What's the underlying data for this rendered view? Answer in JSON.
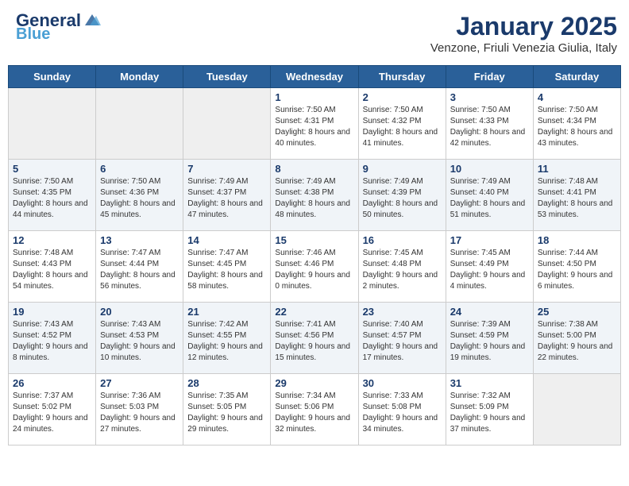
{
  "header": {
    "logo_general": "General",
    "logo_blue": "Blue",
    "title": "January 2025",
    "subtitle": "Venzone, Friuli Venezia Giulia, Italy"
  },
  "weekdays": [
    "Sunday",
    "Monday",
    "Tuesday",
    "Wednesday",
    "Thursday",
    "Friday",
    "Saturday"
  ],
  "weeks": [
    {
      "days": [
        {
          "num": "",
          "empty": true
        },
        {
          "num": "",
          "empty": true
        },
        {
          "num": "",
          "empty": true
        },
        {
          "num": "1",
          "rise": "7:50 AM",
          "set": "4:31 PM",
          "daylight": "8 hours and 40 minutes."
        },
        {
          "num": "2",
          "rise": "7:50 AM",
          "set": "4:32 PM",
          "daylight": "8 hours and 41 minutes."
        },
        {
          "num": "3",
          "rise": "7:50 AM",
          "set": "4:33 PM",
          "daylight": "8 hours and 42 minutes."
        },
        {
          "num": "4",
          "rise": "7:50 AM",
          "set": "4:34 PM",
          "daylight": "8 hours and 43 minutes."
        }
      ]
    },
    {
      "days": [
        {
          "num": "5",
          "rise": "7:50 AM",
          "set": "4:35 PM",
          "daylight": "8 hours and 44 minutes."
        },
        {
          "num": "6",
          "rise": "7:50 AM",
          "set": "4:36 PM",
          "daylight": "8 hours and 45 minutes."
        },
        {
          "num": "7",
          "rise": "7:49 AM",
          "set": "4:37 PM",
          "daylight": "8 hours and 47 minutes."
        },
        {
          "num": "8",
          "rise": "7:49 AM",
          "set": "4:38 PM",
          "daylight": "8 hours and 48 minutes."
        },
        {
          "num": "9",
          "rise": "7:49 AM",
          "set": "4:39 PM",
          "daylight": "8 hours and 50 minutes."
        },
        {
          "num": "10",
          "rise": "7:49 AM",
          "set": "4:40 PM",
          "daylight": "8 hours and 51 minutes."
        },
        {
          "num": "11",
          "rise": "7:48 AM",
          "set": "4:41 PM",
          "daylight": "8 hours and 53 minutes."
        }
      ]
    },
    {
      "days": [
        {
          "num": "12",
          "rise": "7:48 AM",
          "set": "4:43 PM",
          "daylight": "8 hours and 54 minutes."
        },
        {
          "num": "13",
          "rise": "7:47 AM",
          "set": "4:44 PM",
          "daylight": "8 hours and 56 minutes."
        },
        {
          "num": "14",
          "rise": "7:47 AM",
          "set": "4:45 PM",
          "daylight": "8 hours and 58 minutes."
        },
        {
          "num": "15",
          "rise": "7:46 AM",
          "set": "4:46 PM",
          "daylight": "9 hours and 0 minutes."
        },
        {
          "num": "16",
          "rise": "7:45 AM",
          "set": "4:48 PM",
          "daylight": "9 hours and 2 minutes."
        },
        {
          "num": "17",
          "rise": "7:45 AM",
          "set": "4:49 PM",
          "daylight": "9 hours and 4 minutes."
        },
        {
          "num": "18",
          "rise": "7:44 AM",
          "set": "4:50 PM",
          "daylight": "9 hours and 6 minutes."
        }
      ]
    },
    {
      "days": [
        {
          "num": "19",
          "rise": "7:43 AM",
          "set": "4:52 PM",
          "daylight": "9 hours and 8 minutes."
        },
        {
          "num": "20",
          "rise": "7:43 AM",
          "set": "4:53 PM",
          "daylight": "9 hours and 10 minutes."
        },
        {
          "num": "21",
          "rise": "7:42 AM",
          "set": "4:55 PM",
          "daylight": "9 hours and 12 minutes."
        },
        {
          "num": "22",
          "rise": "7:41 AM",
          "set": "4:56 PM",
          "daylight": "9 hours and 15 minutes."
        },
        {
          "num": "23",
          "rise": "7:40 AM",
          "set": "4:57 PM",
          "daylight": "9 hours and 17 minutes."
        },
        {
          "num": "24",
          "rise": "7:39 AM",
          "set": "4:59 PM",
          "daylight": "9 hours and 19 minutes."
        },
        {
          "num": "25",
          "rise": "7:38 AM",
          "set": "5:00 PM",
          "daylight": "9 hours and 22 minutes."
        }
      ]
    },
    {
      "days": [
        {
          "num": "26",
          "rise": "7:37 AM",
          "set": "5:02 PM",
          "daylight": "9 hours and 24 minutes."
        },
        {
          "num": "27",
          "rise": "7:36 AM",
          "set": "5:03 PM",
          "daylight": "9 hours and 27 minutes."
        },
        {
          "num": "28",
          "rise": "7:35 AM",
          "set": "5:05 PM",
          "daylight": "9 hours and 29 minutes."
        },
        {
          "num": "29",
          "rise": "7:34 AM",
          "set": "5:06 PM",
          "daylight": "9 hours and 32 minutes."
        },
        {
          "num": "30",
          "rise": "7:33 AM",
          "set": "5:08 PM",
          "daylight": "9 hours and 34 minutes."
        },
        {
          "num": "31",
          "rise": "7:32 AM",
          "set": "5:09 PM",
          "daylight": "9 hours and 37 minutes."
        },
        {
          "num": "",
          "empty": true
        }
      ]
    }
  ],
  "labels": {
    "sunrise": "Sunrise:",
    "sunset": "Sunset:",
    "daylight": "Daylight:"
  }
}
